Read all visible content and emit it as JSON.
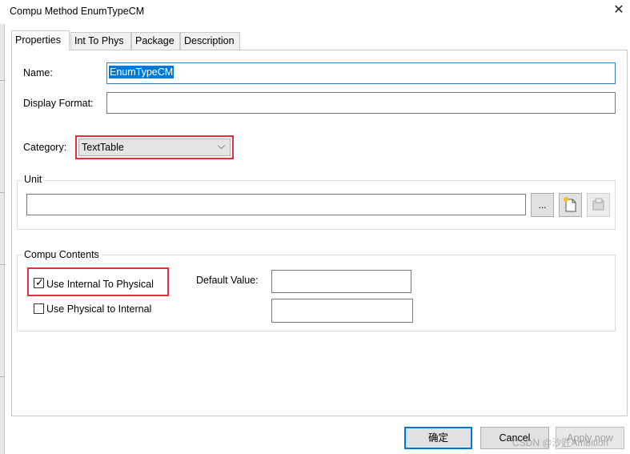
{
  "window": {
    "title": "Compu Method EnumTypeCM",
    "close_glyph": "✕"
  },
  "tabs": [
    {
      "label": "Properties",
      "active": true
    },
    {
      "label": "Int To Phys",
      "active": false
    },
    {
      "label": "Package",
      "active": false
    },
    {
      "label": "Description",
      "active": false
    }
  ],
  "properties": {
    "name_label": "Name:",
    "name_value": "EnumTypeCM",
    "display_format_label": "Display Format:",
    "display_format_value": "",
    "category_label": "Category:",
    "category_value": "TextTable",
    "unit_group_title": "Unit",
    "unit_value": "",
    "unit_browse_label": "...",
    "compu_group_title": "Compu Contents",
    "use_internal_label": "Use Internal To Physical",
    "use_internal_checked": true,
    "use_physical_label": "Use Physical to Internal",
    "use_physical_checked": false,
    "default_value_label": "Default Value:",
    "default_value_1": "",
    "default_value_2": ""
  },
  "buttons": {
    "ok_label": "确定",
    "cancel_label": "Cancel",
    "apply_label": "Apply now"
  },
  "watermark": "CSDN @沙匠Ambition",
  "colors": {
    "highlight_red": "#e0303a",
    "selection_blue": "#0078d7"
  }
}
